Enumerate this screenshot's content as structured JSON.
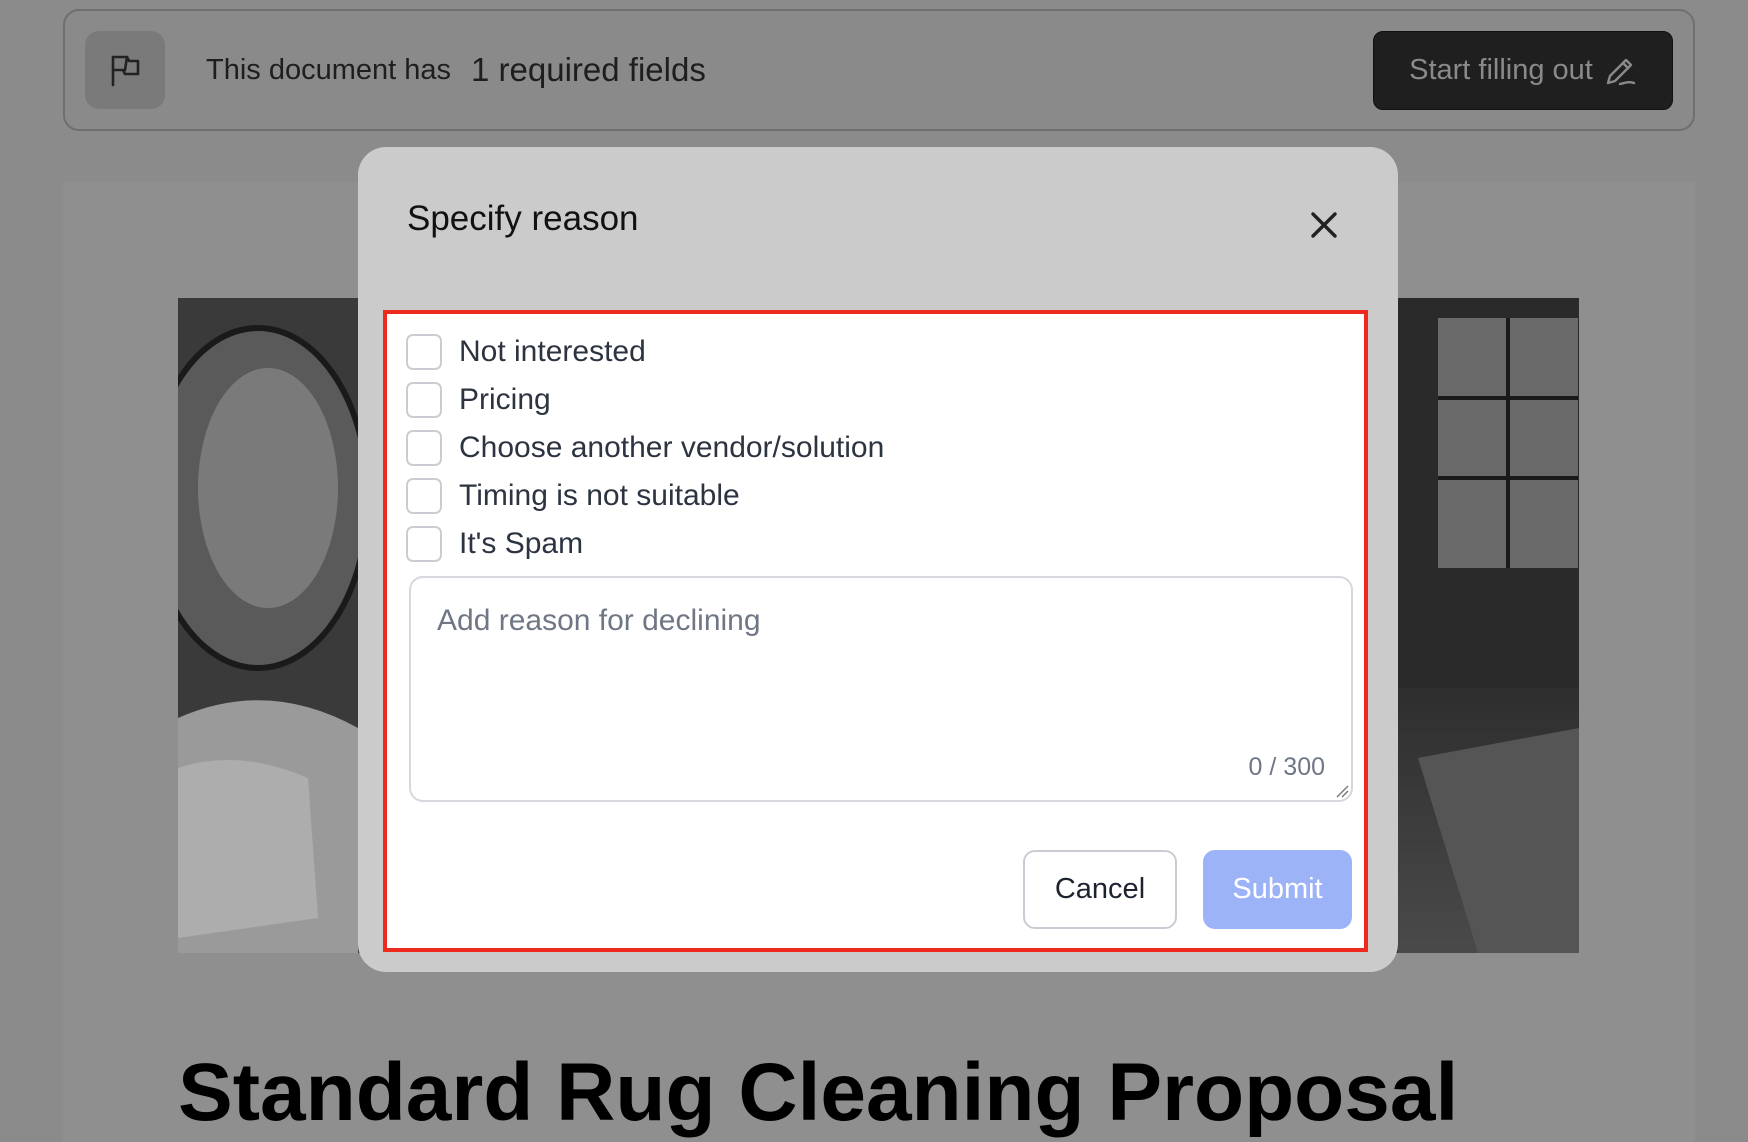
{
  "topbar": {
    "notice_text": "This document has",
    "required_count_text": "1 required fields",
    "start_button_label": "Start filling out",
    "flag_icon": "flag-icon",
    "pen_icon": "pen-icon"
  },
  "document": {
    "title": "Standard Rug Cleaning Proposal"
  },
  "modal": {
    "title": "Specify reason",
    "close_icon": "close-icon",
    "reasons": [
      {
        "label": "Not interested",
        "checked": false
      },
      {
        "label": "Pricing",
        "checked": false
      },
      {
        "label": "Choose another vendor/solution",
        "checked": false
      },
      {
        "label": "Timing is not suitable",
        "checked": false
      },
      {
        "label": "It's Spam",
        "checked": false
      }
    ],
    "textarea": {
      "placeholder": "Add reason for declining",
      "counter": "0 / 300"
    },
    "cancel_label": "Cancel",
    "submit_label": "Submit"
  },
  "colors": {
    "highlight_border": "#ee2a1f",
    "submit_bg": "#9db3f7",
    "overlay_bg": "#8b8b8b"
  }
}
